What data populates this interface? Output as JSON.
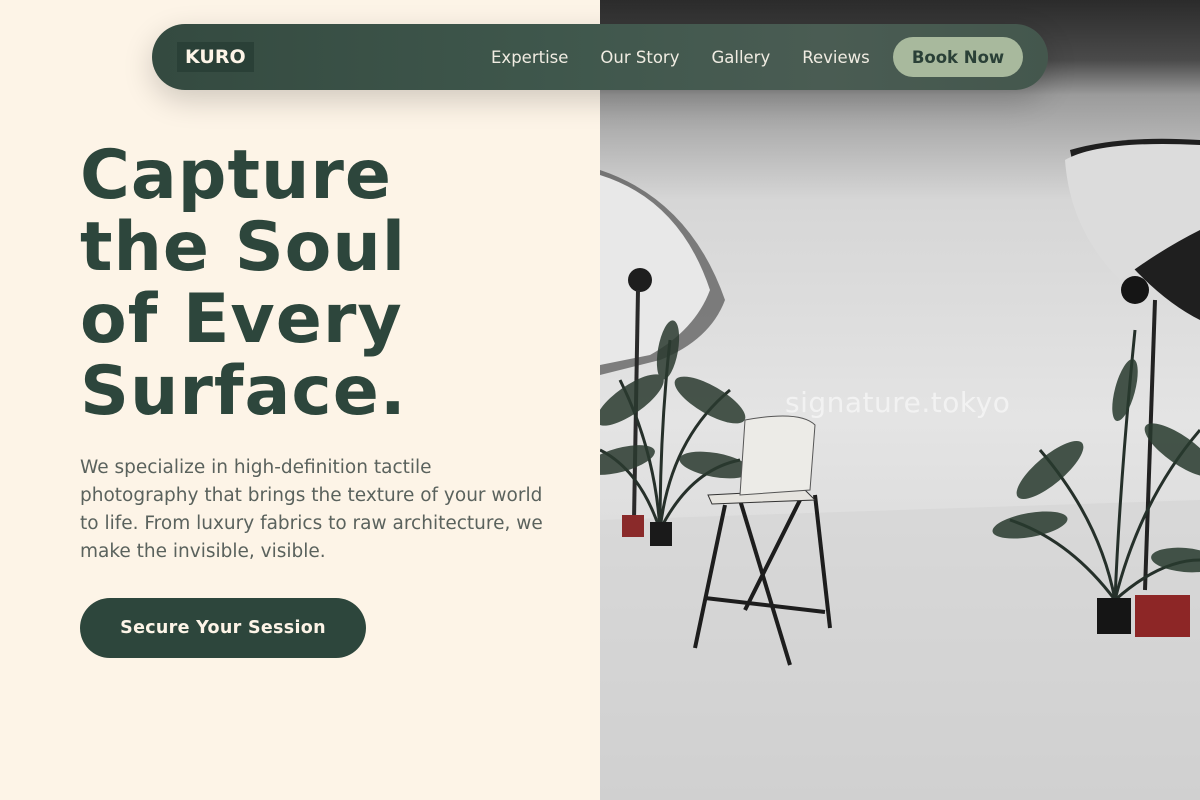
{
  "brand": {
    "logo": "KURO"
  },
  "nav": {
    "links": [
      "Expertise",
      "Our Story",
      "Gallery",
      "Reviews"
    ],
    "book_label": "Book Now"
  },
  "hero": {
    "headline_lines": [
      "Capture",
      "the Soul",
      "of Every",
      "Surface."
    ],
    "subtext": "We specialize in high-definition tactile photography that brings the texture of your world to life. From luxury fabrics to raw architecture, we make the invisible, visible.",
    "cta_label": "Secure Your Session",
    "image_watermark": "signature.tokyo"
  },
  "colors": {
    "background": "#fdf4e7",
    "primary": "#2d463c",
    "accent": "#a8b99d",
    "nav": "#3f574c"
  }
}
